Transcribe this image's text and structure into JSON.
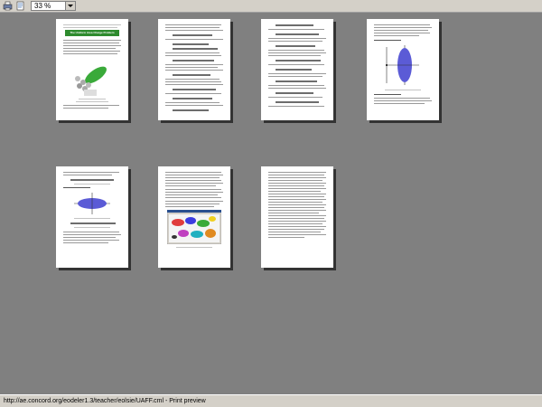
{
  "toolbar": {
    "zoom_value": "33 %",
    "icons": [
      "print-icon",
      "page-setup-icon"
    ]
  },
  "pages": [
    {
      "number": 1,
      "heading": "The Uniform Area Charge Problem"
    },
    {
      "number": 2
    },
    {
      "number": 3
    },
    {
      "number": 4
    },
    {
      "number": 5
    },
    {
      "number": 6
    },
    {
      "number": 7
    }
  ],
  "status": {
    "text": "http://ae.concord.org/eodeler1.3/teacher/eolsie/UAFF.cml - Print preview"
  },
  "colors": {
    "workspace": "#808080",
    "chrome": "#d4d0c8",
    "banner_green": "#2e8b2e",
    "ellipse_blue": "#5b5bd6",
    "ellipse_green": "#3aaa3a"
  }
}
